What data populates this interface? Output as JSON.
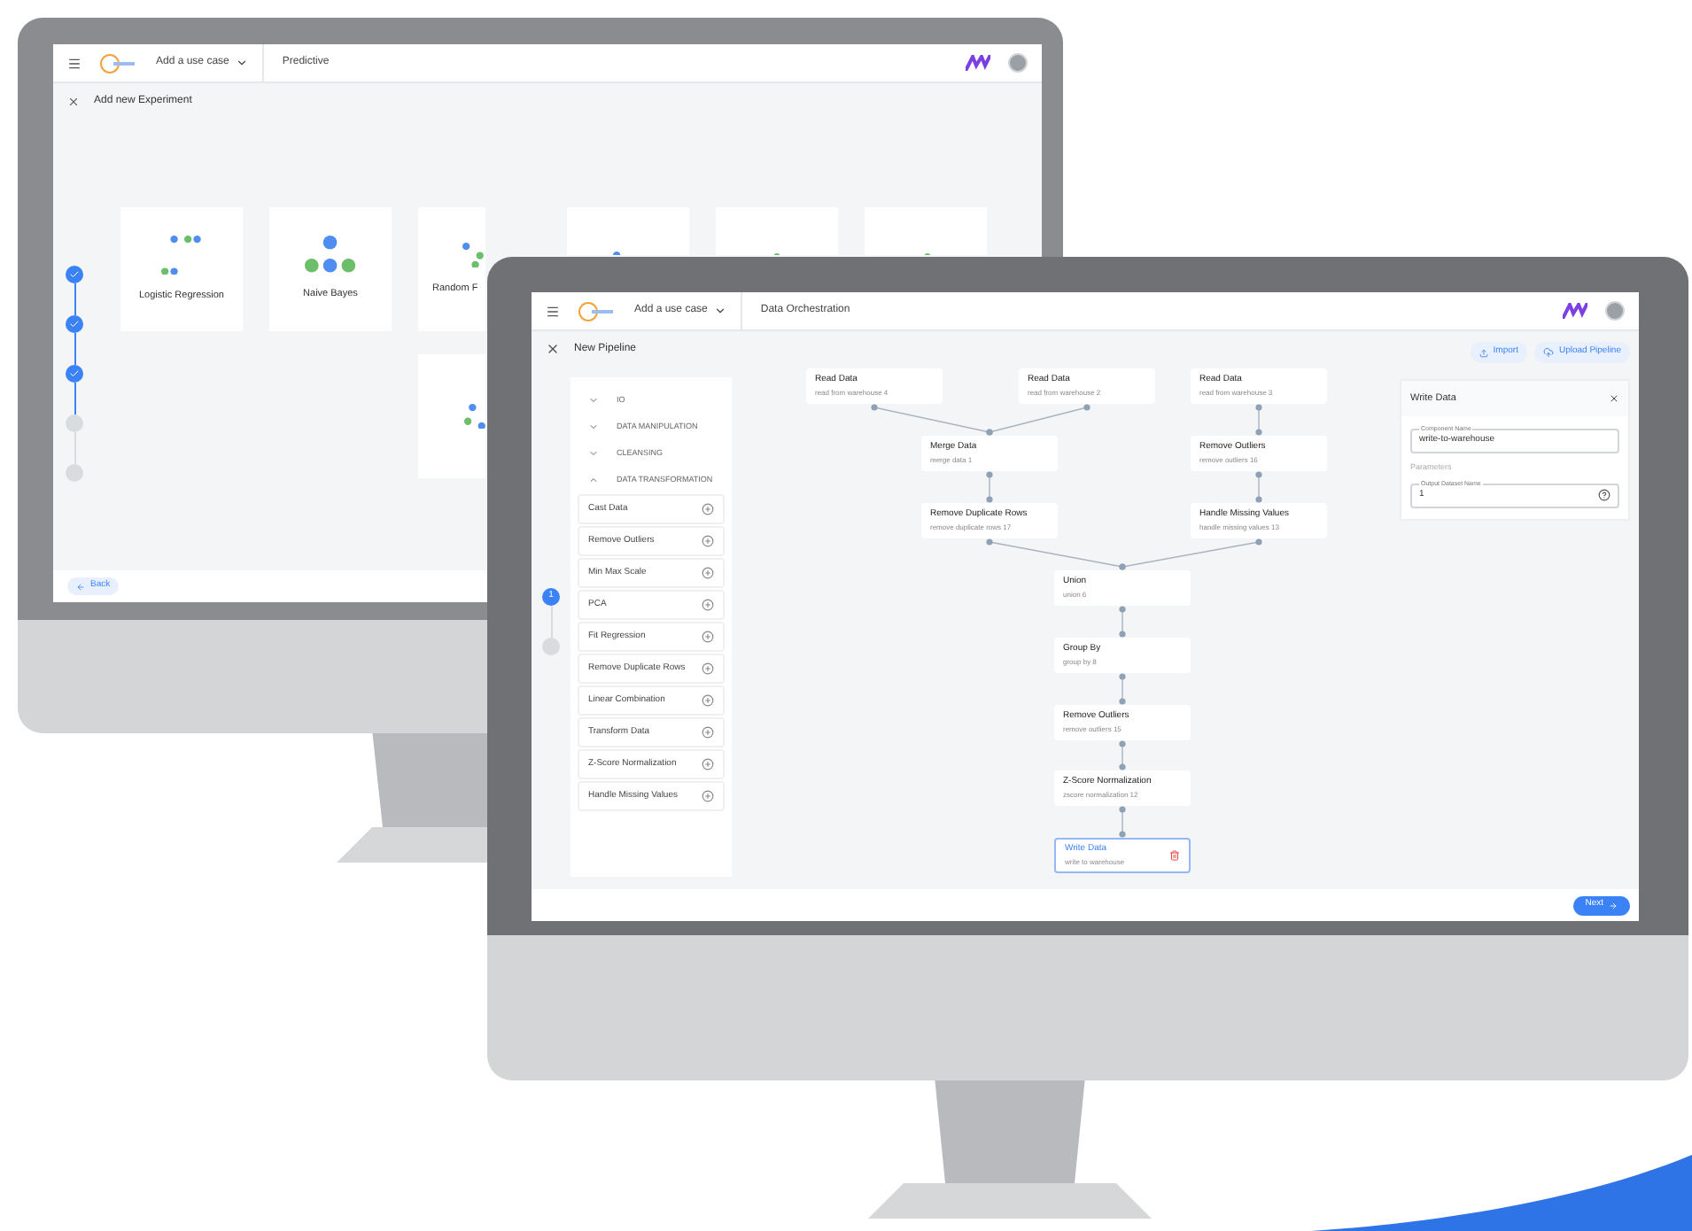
{
  "back_screen": {
    "header": {
      "use_case": "Add a use case",
      "breadcrumb": "Predictive"
    },
    "title": "Add new Experiment",
    "steps": [
      {
        "done": true
      },
      {
        "done": true
      },
      {
        "done": true
      },
      {
        "done": false
      },
      {
        "done": false
      }
    ],
    "cards": [
      {
        "kind": "labeled",
        "label": "Logistic Regression"
      },
      {
        "kind": "labeled",
        "label": "Naive Bayes"
      },
      {
        "kind": "labeled",
        "label": "Random F"
      },
      {
        "kind": "picture"
      },
      {
        "kind": "picture"
      },
      {
        "kind": "picture"
      },
      {
        "kind": "picture"
      }
    ],
    "back_button": "Back"
  },
  "front_screen": {
    "header": {
      "use_case": "Add a use case",
      "breadcrumb": "Data Orchestration"
    },
    "title": "New Pipeline",
    "steps": [
      {
        "selected": true,
        "label": "1"
      },
      {
        "selected": false
      }
    ],
    "groups": [
      {
        "label": "IO",
        "expanded": false
      },
      {
        "label": "DATA MANIPULATION",
        "expanded": false
      },
      {
        "label": "CLEANSING",
        "expanded": false
      },
      {
        "label": "DATA TRANSFORMATION",
        "expanded": true
      }
    ],
    "components": [
      "Cast Data",
      "Remove Outliers",
      "Min Max Scale",
      "PCA",
      "Fit Regression",
      "Remove Duplicate Rows",
      "Linear Combination",
      "Transform Data",
      "Z-Score Normalization",
      "Handle Missing Values"
    ],
    "nodes": [
      {
        "name": "Read Data",
        "id_text": "read from warehouse 4",
        "selected": false
      },
      {
        "name": "Read Data",
        "id_text": "read from warehouse 2",
        "selected": false
      },
      {
        "name": "Read Data",
        "id_text": "read from warehouse 3",
        "selected": false
      },
      {
        "name": "Merge Data",
        "id_text": "merge data 1",
        "selected": false
      },
      {
        "name": "Remove Outliers",
        "id_text": "remove outliers 16",
        "selected": false
      },
      {
        "name": "Remove Duplicate Rows",
        "id_text": "remove duplicate rows 17",
        "selected": false
      },
      {
        "name": "Handle Missing Values",
        "id_text": "handle missing values 13",
        "selected": false
      },
      {
        "name": "Union",
        "id_text": "union 6",
        "selected": false
      },
      {
        "name": "Group By",
        "id_text": "group by 8",
        "selected": false
      },
      {
        "name": "Remove Outliers",
        "id_text": "remove outliers 15",
        "selected": false
      },
      {
        "name": "Z-Score Normalization",
        "id_text": "zscore normalization 12",
        "selected": false
      },
      {
        "name": "Write Data",
        "id_text": "write to warehouse",
        "selected": true
      }
    ],
    "import_button": "Import",
    "upload_button": "Upload Pipeline",
    "panel": {
      "title": "Write Data",
      "name_label": "Component Name",
      "name_value": "write-to-warehouse",
      "section": "Parameters",
      "param_label": "Output Dataset Name",
      "param_value": "1"
    },
    "next_button": "Next"
  }
}
